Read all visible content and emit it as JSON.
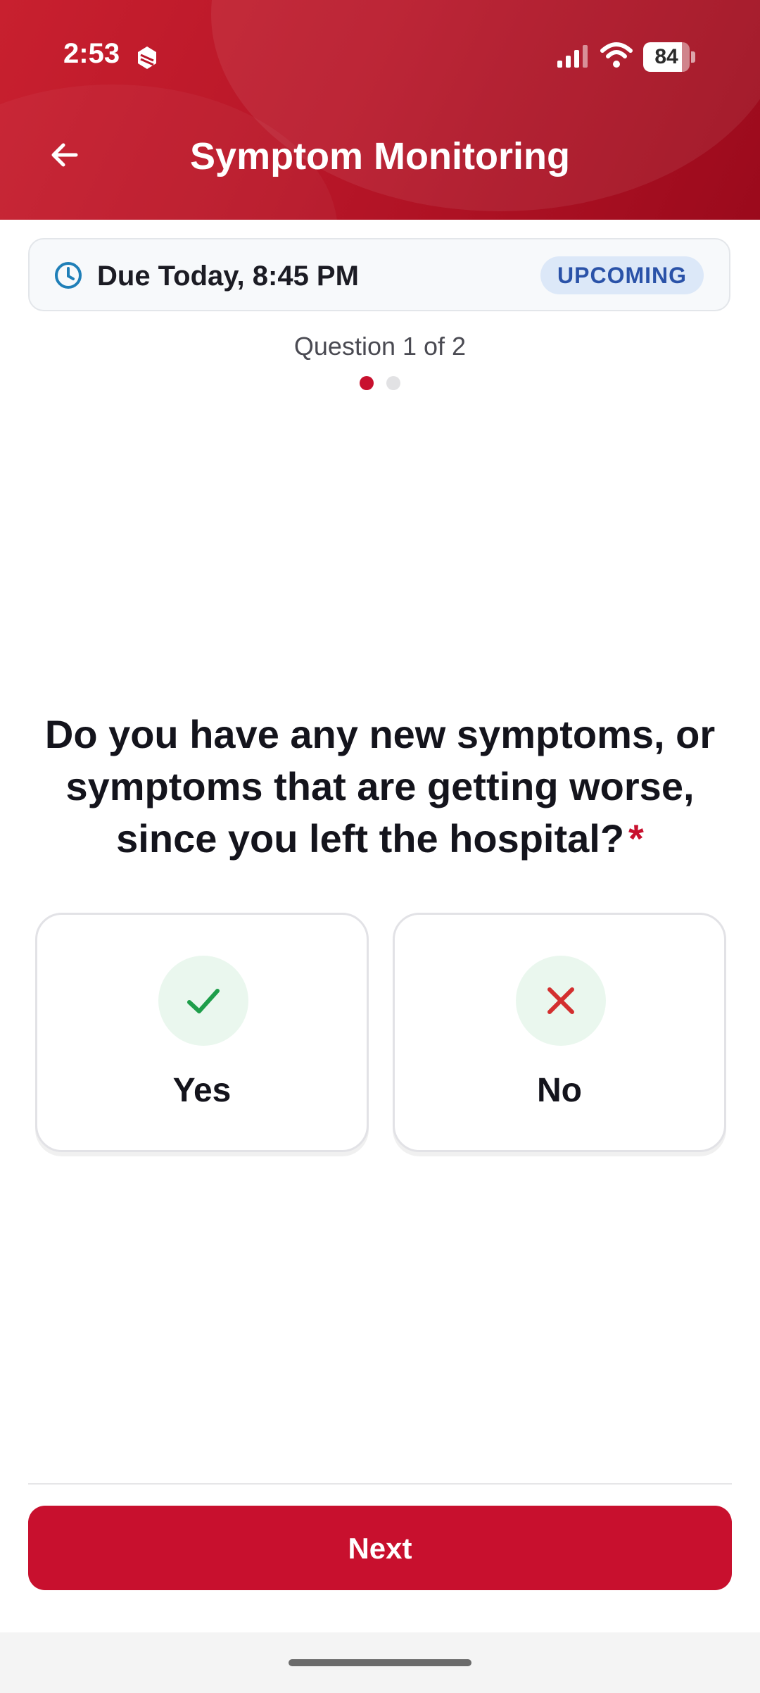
{
  "status_bar": {
    "time": "2:53",
    "battery_percent": "84",
    "battery_level": 0.84
  },
  "header": {
    "title": "Symptom Monitoring",
    "back_icon": "arrow-left-icon"
  },
  "due_card": {
    "due_text": "Due Today, 8:45 PM",
    "badge": "UPCOMING",
    "icon": "clock-icon"
  },
  "progress": {
    "label": "Question 1 of 2",
    "current": 1,
    "total": 2
  },
  "question": {
    "text": "Do you have any new symptoms, or symptoms that are getting worse, since you left the hospital?",
    "required_marker": "*"
  },
  "options": [
    {
      "label": "Yes",
      "icon": "check-icon"
    },
    {
      "label": "No",
      "icon": "x-icon"
    }
  ],
  "footer": {
    "next_label": "Next"
  },
  "colors": {
    "brand": "#c8102e",
    "badge_bg": "#dce8f8",
    "badge_text": "#2a52a8",
    "check": "#1e9e4a",
    "cross": "#d32f2f",
    "option_circle": "#eaf7ee"
  }
}
